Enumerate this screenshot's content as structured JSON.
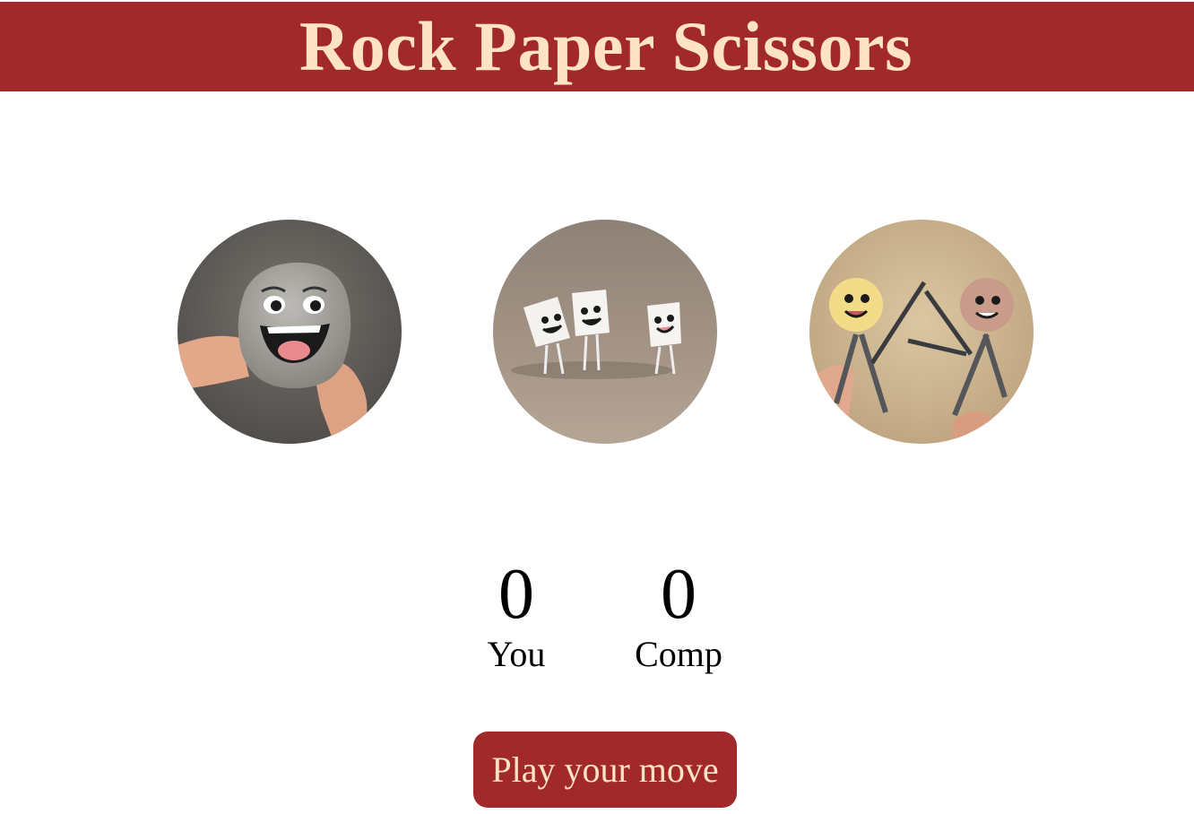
{
  "header": {
    "title": "Rock Paper Scissors"
  },
  "choices": [
    {
      "id": "rock",
      "icon": "smiling-rock-image"
    },
    {
      "id": "paper",
      "icon": "dancing-paper-image"
    },
    {
      "id": "scissors",
      "icon": "smiling-scissors-image"
    }
  ],
  "scoreboard": {
    "user": {
      "score": "0",
      "label": "You"
    },
    "comp": {
      "score": "0",
      "label": "Comp"
    }
  },
  "message": {
    "text": "Play your move"
  },
  "colors": {
    "brand": "#a2292b",
    "brand_text": "#ffe3c4",
    "background": "#ffffff"
  }
}
